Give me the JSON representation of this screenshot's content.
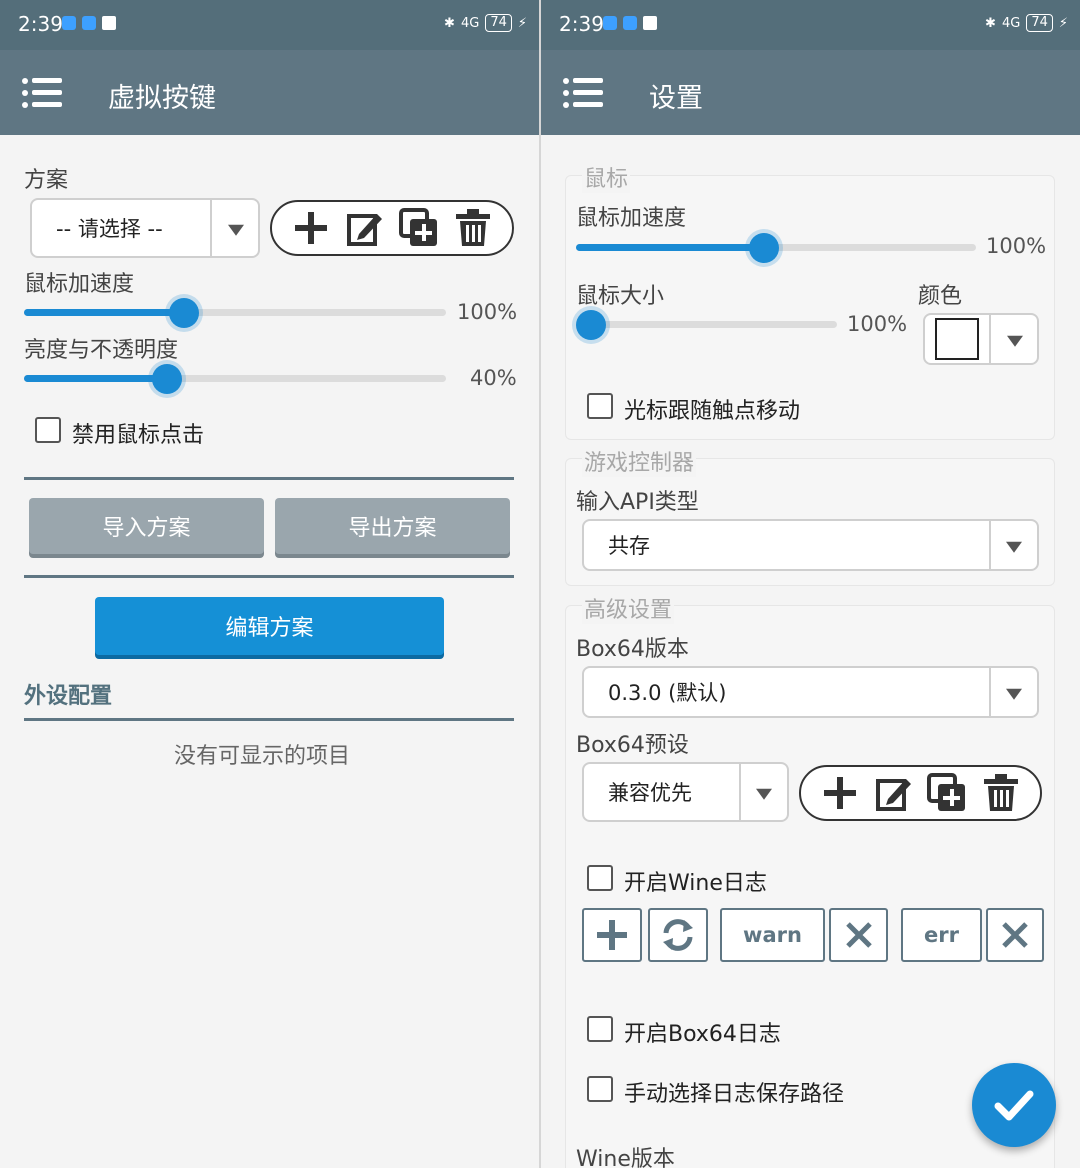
{
  "status": {
    "time": "2:39",
    "battery": "74",
    "signal": "4G"
  },
  "left": {
    "title": "虚拟按键",
    "scheme_label": "方案",
    "scheme_select": "-- 请选择 --",
    "mouse_speed_label": "鼠标加速度",
    "mouse_speed_value": "100%",
    "mouse_speed_level": 0.38,
    "brightness_label": "亮度与不透明度",
    "brightness_value": "40%",
    "brightness_level": 0.34,
    "disable_click_label": "禁用鼠标点击",
    "import_label": "导入方案",
    "export_label": "导出方案",
    "edit_label": "编辑方案",
    "peripheral_label": "外设配置",
    "empty_text": "没有可显示的项目"
  },
  "right": {
    "title": "设置",
    "mouse_section": "鼠标",
    "mouse_speed_label": "鼠标加速度",
    "mouse_speed_value": "100%",
    "mouse_speed_level": 0.47,
    "mouse_size_label": "鼠标大小",
    "mouse_size_value": "100%",
    "mouse_size_level": 0.0,
    "color_label": "颜色",
    "follow_touch_label": "光标跟随触点移动",
    "gamepad_section": "游戏控制器",
    "input_api_label": "输入API类型",
    "input_api_value": "共存",
    "advanced_section": "高级设置",
    "box64_version_label": "Box64版本",
    "box64_version_value": "0.3.0 (默认)",
    "box64_preset_label": "Box64预设",
    "box64_preset_value": "兼容优先",
    "wine_log_label": "开启Wine日志",
    "warn_label": "warn",
    "err_label": "err",
    "box64_log_label": "开启Box64日志",
    "manual_log_path_label": "手动选择日志保存路径",
    "wine_version_label": "Wine版本"
  },
  "colors": {
    "toolbar": "#5f7683",
    "accent": "#1a8ad3",
    "status_bar": "#546e7a"
  }
}
